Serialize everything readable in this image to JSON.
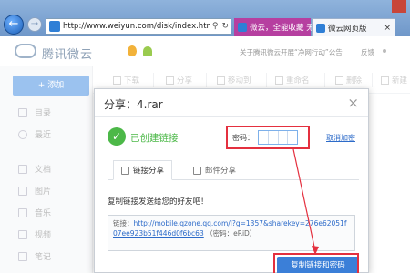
{
  "browser": {
    "url": "http://www.weiyun.com/disk/index.html?",
    "tabs": [
      {
        "label": "微云，全能收藏 无..."
      },
      {
        "label": "微云网页版"
      }
    ]
  },
  "header": {
    "logo": "腾讯微云",
    "notice": "关于腾讯微云开展“净网行动”公告",
    "feedback": "反馈"
  },
  "sidebar": {
    "add_label": "+ 添加",
    "items": [
      {
        "label": "目录"
      },
      {
        "label": "最近"
      },
      {
        "label": "文档"
      },
      {
        "label": "图片"
      },
      {
        "label": "音乐"
      },
      {
        "label": "视频"
      },
      {
        "label": "笔记"
      }
    ]
  },
  "toolbar": {
    "buttons": [
      {
        "label": "下载"
      },
      {
        "label": "分享"
      },
      {
        "label": "移动到"
      },
      {
        "label": "重命名"
      },
      {
        "label": "删除"
      },
      {
        "label": "新建"
      }
    ]
  },
  "dialog": {
    "title": "分享：4.rar",
    "success": "已创建链接",
    "password_label": "密码：",
    "cancel_encrypt": "取消加密",
    "tabs": [
      {
        "label": "链接分享"
      },
      {
        "label": "邮件分享"
      }
    ],
    "copy_hint": "复制链接发送给您的好友吧！",
    "link_prefix": "链接：",
    "link_url": "http://mobile.qzone.qq.com/l?g=1357&sharekey=276e62051f07ee923b51f446d0f6bc63",
    "link_suffix": "（密码：eRiD）",
    "copy_button": "复制链接和密码"
  },
  "colors": {
    "accent_blue": "#3b7fd8",
    "success_green": "#4cb848",
    "annotation_red": "#e4303f"
  }
}
